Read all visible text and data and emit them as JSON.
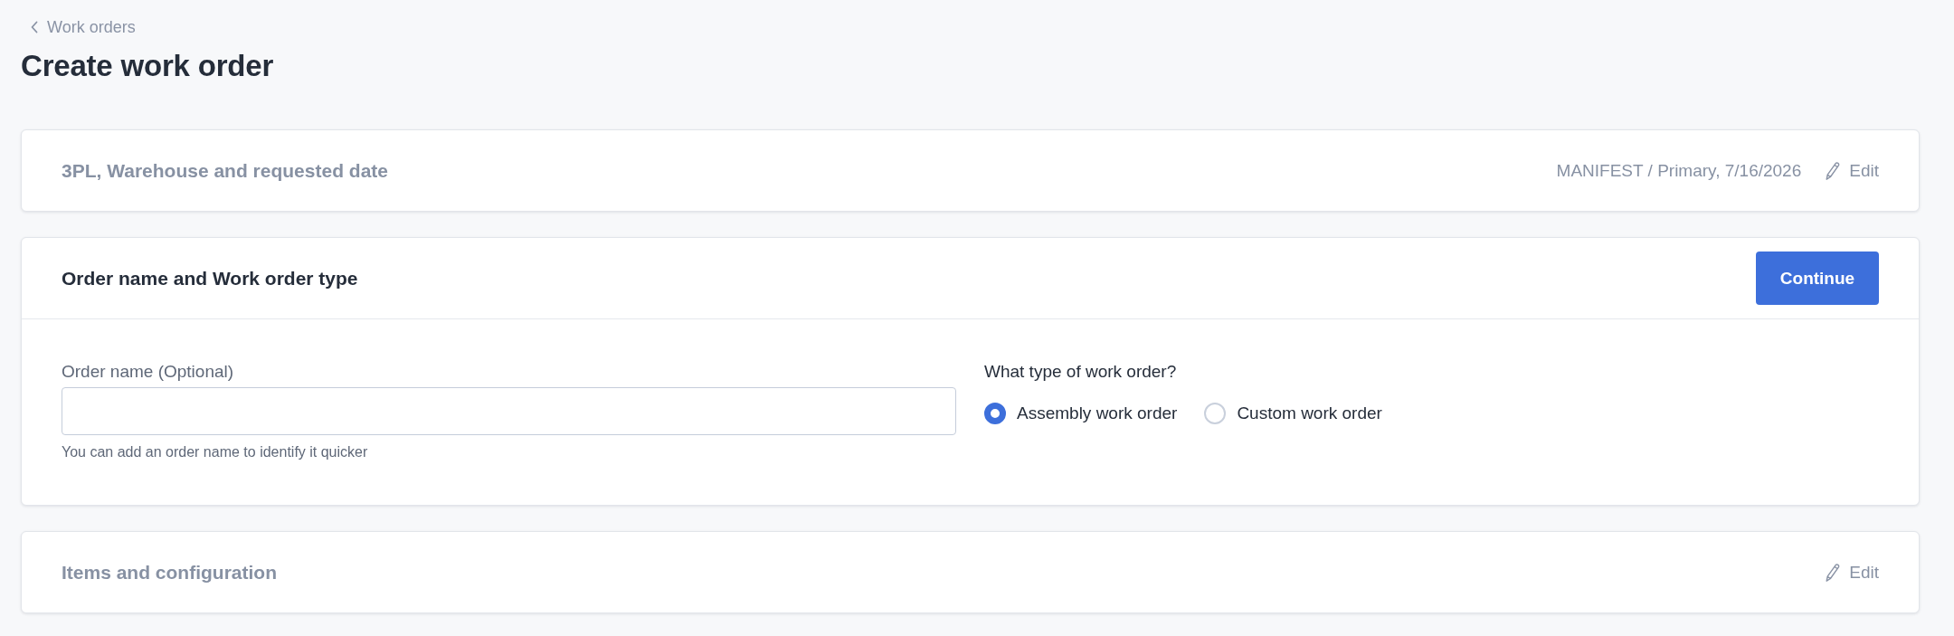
{
  "breadcrumb": {
    "label": "Work orders"
  },
  "page_title": "Create work order",
  "sections": [
    {
      "kind": "collapsed",
      "title": "3PL, Warehouse and requested date",
      "summary": "MANIFEST / Primary, 7/16/2026",
      "edit_label": "Edit"
    },
    {
      "kind": "expanded",
      "title": "Order name and Work order type",
      "action": "Continue",
      "order_name": {
        "label": "Order name (Optional)",
        "hint": "You can add an order name to identify it quicker"
      },
      "work_order_type": {
        "question": "What type of work order?",
        "options": [
          {
            "label": "Assembly work order",
            "selected": true
          },
          {
            "label": "Custom work order",
            "selected": false
          }
        ]
      }
    },
    {
      "kind": "collapsed",
      "title": "Items and configuration",
      "edit_label": "Edit"
    }
  ]
}
